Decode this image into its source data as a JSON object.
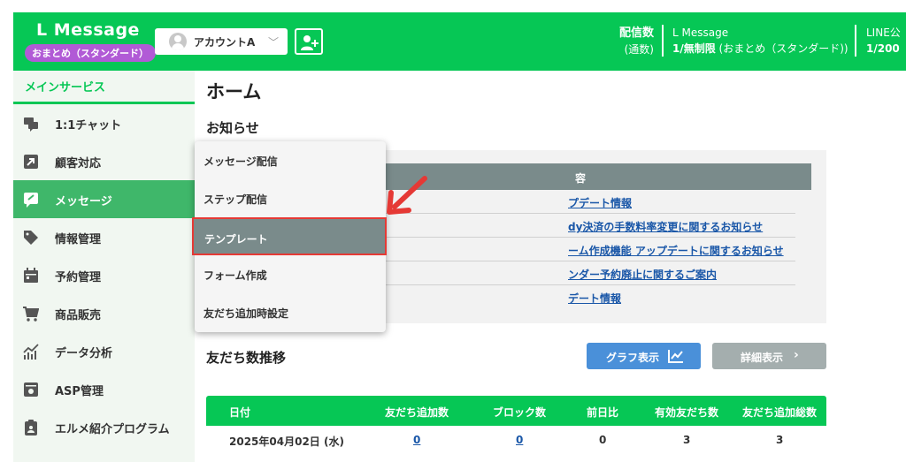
{
  "header": {
    "logo": "L Message",
    "plan_badge": "おまとめ（スタンダード）",
    "account": "アカウントA",
    "stat_label_top": "配信数",
    "stat_label_bottom": "(通数)",
    "plan_title": "L Message",
    "plan_value_bold": "1/無制限",
    "plan_value_rest": " (おまとめ（スタンダード))",
    "line_title": "LINE公",
    "line_value": "1/200",
    "colors": {
      "brand": "#06c755",
      "badge": "#b15ad6"
    }
  },
  "sidebar": {
    "heading": "メインサービス",
    "items": [
      {
        "label": "1:1チャット",
        "icon": "chat-icon"
      },
      {
        "label": "顧客対応",
        "icon": "arrow-box-icon"
      },
      {
        "label": "メッセージ",
        "icon": "message-icon"
      },
      {
        "label": "情報管理",
        "icon": "tag-icon"
      },
      {
        "label": "予約管理",
        "icon": "calendar-icon"
      },
      {
        "label": "商品販売",
        "icon": "cart-icon"
      },
      {
        "label": "データ分析",
        "icon": "analytics-icon"
      },
      {
        "label": "ASP管理",
        "icon": "asp-icon"
      },
      {
        "label": "エルメ紹介プログラム",
        "icon": "clipboard-icon"
      }
    ]
  },
  "main": {
    "title": "ホーム",
    "news_title": "お知らせ",
    "news_header": "容",
    "news": [
      "プデート情報",
      "dy決済の手数料率変更に関するお知らせ",
      "ーム作成機能 アップデートに関するお知らせ",
      "ンダー予約廃止に関するご案内",
      "デート情報"
    ],
    "friends_title": "友だち数推移",
    "graph_button": "グラフ表示",
    "detail_button": "詳細表示",
    "table": {
      "headers": [
        "日付",
        "友だち追加数",
        "ブロック数",
        "前日比",
        "有効友だち数",
        "友だち追加総数"
      ],
      "rows": [
        [
          "2025年04月02日 (水)",
          "0",
          "0",
          "0",
          "3",
          "3"
        ]
      ]
    }
  },
  "dropdown": {
    "items": [
      "メッセージ配信",
      "ステップ配信",
      "テンプレート",
      "フォーム作成",
      "友だち追加時設定"
    ],
    "active_index": 2
  }
}
